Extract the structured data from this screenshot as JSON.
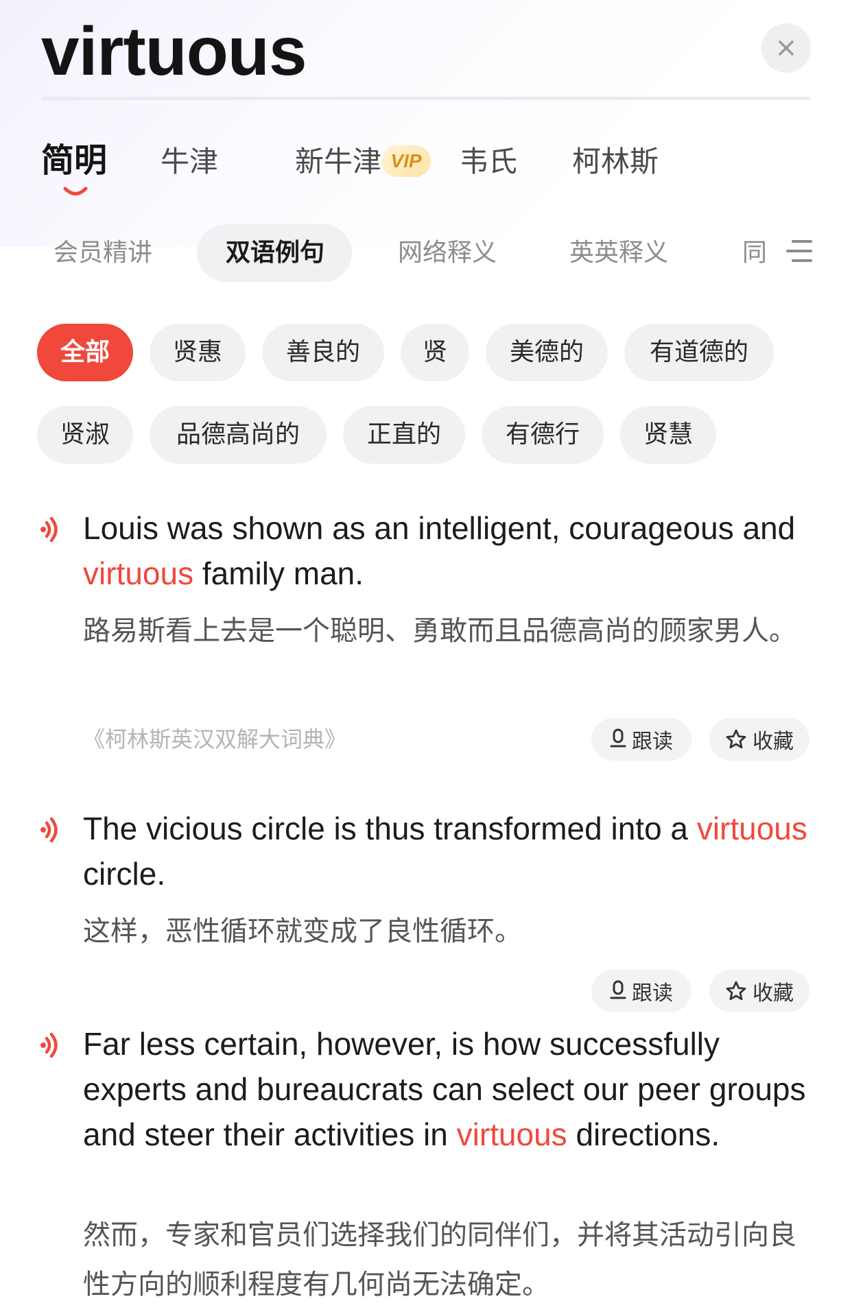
{
  "header": {
    "headword": "virtuous",
    "close_icon": "close-icon"
  },
  "dict_tabs": [
    {
      "label": "简明",
      "active": true
    },
    {
      "label": "牛津",
      "active": false
    },
    {
      "label": "新牛津",
      "active": false,
      "badge": "VIP"
    },
    {
      "label": "韦氏",
      "active": false
    },
    {
      "label": "柯林斯",
      "active": false
    }
  ],
  "section_tabs": [
    {
      "label": "会员精讲",
      "active": false
    },
    {
      "label": "双语例句",
      "active": true
    },
    {
      "label": "网络释义",
      "active": false
    },
    {
      "label": "英英释义",
      "active": false
    },
    {
      "label": "同",
      "active": false
    }
  ],
  "menu_icon": "menu-icon",
  "filter_chips": [
    {
      "label": "全部",
      "active": true
    },
    {
      "label": "贤惠"
    },
    {
      "label": "善良的"
    },
    {
      "label": "贤"
    },
    {
      "label": "美德的"
    },
    {
      "label": "有道德的"
    },
    {
      "label": "贤淑"
    },
    {
      "label": "品德高尚的"
    },
    {
      "label": "正直的"
    },
    {
      "label": "有德行"
    },
    {
      "label": "贤慧"
    }
  ],
  "examples": [
    {
      "en_before": "Louis was shown as an intelligent, courageous and ",
      "en_highlight": "virtuous",
      "en_after": " family man.",
      "zh": "路易斯看上去是一个聪明、勇敢而且品德高尚的顾家男人。",
      "source": "《柯林斯英汉双解大词典》",
      "follow_read": "跟读",
      "favorite": "收藏"
    },
    {
      "en_before": "The vicious circle is thus transformed into a ",
      "en_highlight": "virtuous",
      "en_after": " circle.",
      "zh": "这样，恶性循环就变成了良性循环。",
      "follow_read": "跟读",
      "favorite": "收藏"
    },
    {
      "en_before": "Far less certain, however, is how successfully experts and bureaucrats can select our peer groups and steer their activities in ",
      "en_highlight": "virtuous",
      "en_after": " directions.",
      "zh": "然而，专家和官员们选择我们的同伴们，并将其活动引向良性方向的顺利程度有几何尚无法确定。"
    }
  ],
  "colors": {
    "accent": "#f0483c",
    "chip_bg": "#f1f1f3",
    "vip_gold": "#d9931a"
  }
}
